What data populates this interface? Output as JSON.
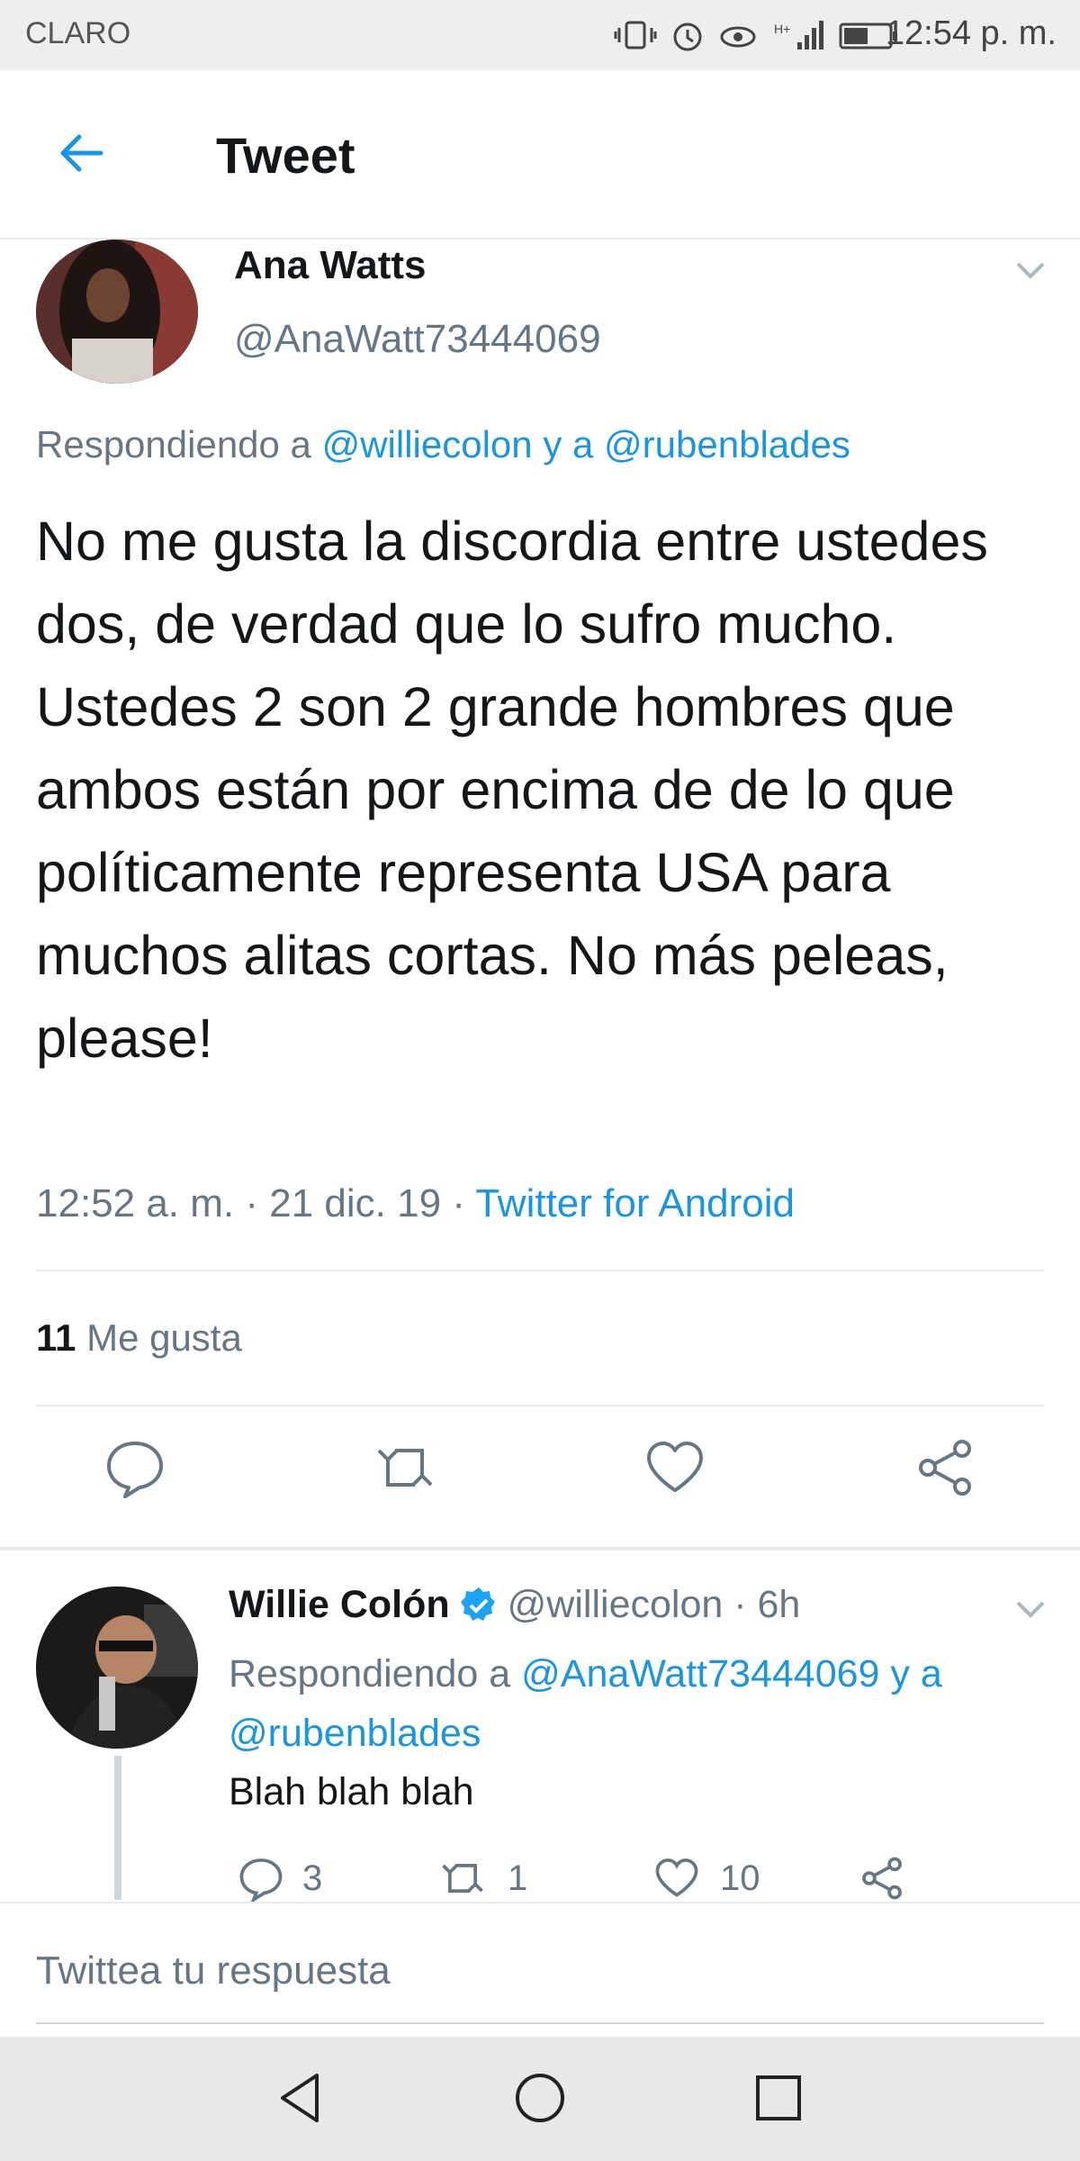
{
  "status_bar": {
    "carrier": "CLARO",
    "time": "12:54 p. m.",
    "icons": [
      "vibrate-icon",
      "alarm-icon",
      "eye-icon",
      "signal-icon",
      "battery-icon"
    ]
  },
  "header": {
    "title": "Tweet",
    "back_icon": "back-arrow-icon"
  },
  "main_tweet": {
    "name": "Ana Watts",
    "handle": "@AnaWatt73444069",
    "replying_prefix": "Respondiendo a",
    "replying_to_1": "@williecolon",
    "replying_joiner": "y a",
    "replying_to_2": "@rubenblades",
    "text": "No me gusta la discordia entre ustedes dos, de verdad que lo sufro mucho. Ustedes 2 son 2 grande hombres que ambos están por encima de de lo que políticamente representa USA para muchos alitas cortas. No más peleas, please!",
    "timestamp": "12:52 a. m. · 21 dic. 19 ·",
    "client": "Twitter for Android",
    "likes_count": "11",
    "likes_label": "Me gusta"
  },
  "reply_tweet": {
    "name": "Willie Colón",
    "handle_time": "@williecolon · 6h",
    "replying_prefix": "Respondiendo a",
    "replying_to_1": "@AnaWatt73444069",
    "replying_joiner": "y a",
    "replying_to_2": "@rubenblades",
    "text": "Blah blah blah",
    "reply_count": "3",
    "retweet_count": "1",
    "like_count": "10"
  },
  "reply_box": {
    "placeholder": "Twittea tu respuesta"
  },
  "colors": {
    "accent": "#1b95e0",
    "muted": "#657786",
    "text": "#14171a",
    "verified": "#1da1f2"
  }
}
